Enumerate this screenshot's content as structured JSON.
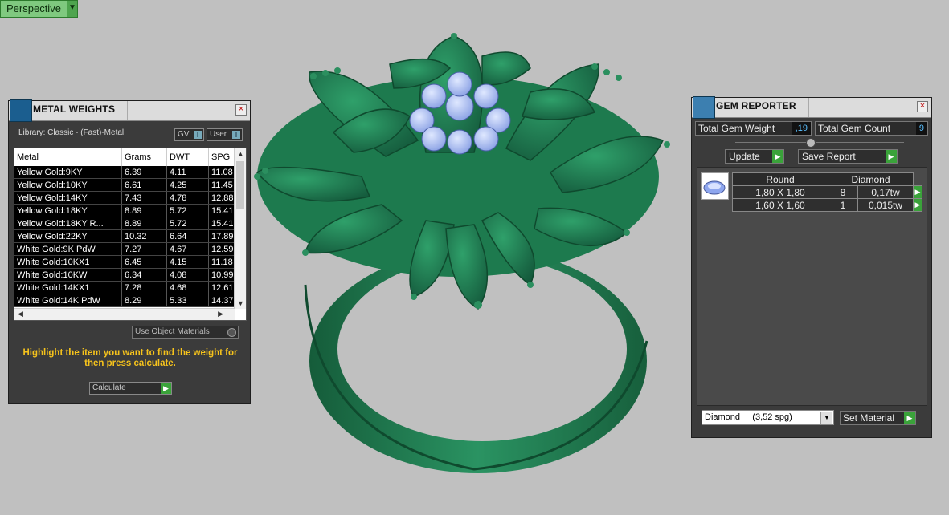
{
  "viewport": {
    "mode_label": "Perspective",
    "dropdown_icon": "chevron-down-icon",
    "colors": {
      "background": "#c0c0c0",
      "metal": "#1f7a4f",
      "gem": "#9cb4f0"
    }
  },
  "metal_weights": {
    "title": "METAL WEIGHTS",
    "library": "Library: Classic - (Fast)-Metal",
    "gv_label": "GV",
    "user_label": "User",
    "columns": [
      "Metal",
      "Grams",
      "DWT",
      "SPG"
    ],
    "rows": [
      {
        "metal": "Yellow Gold:9KY",
        "grams": "6.39",
        "dwt": "4.11",
        "spg": "11.08"
      },
      {
        "metal": "Yellow Gold:10KY",
        "grams": "6.61",
        "dwt": "4.25",
        "spg": "11.45"
      },
      {
        "metal": "Yellow Gold:14KY",
        "grams": "7.43",
        "dwt": "4.78",
        "spg": "12.88"
      },
      {
        "metal": "Yellow Gold:18KY",
        "grams": "8.89",
        "dwt": "5.72",
        "spg": "15.41"
      },
      {
        "metal": "Yellow Gold:18KY R...",
        "grams": "8.89",
        "dwt": "5.72",
        "spg": "15.41"
      },
      {
        "metal": "Yellow Gold:22KY",
        "grams": "10.32",
        "dwt": "6.64",
        "spg": "17.89"
      },
      {
        "metal": "White Gold:9K PdW",
        "grams": "7.27",
        "dwt": "4.67",
        "spg": "12.59"
      },
      {
        "metal": "White Gold:10KX1",
        "grams": "6.45",
        "dwt": "4.15",
        "spg": "11.18"
      },
      {
        "metal": "White Gold:10KW",
        "grams": "6.34",
        "dwt": "4.08",
        "spg": "10.99"
      },
      {
        "metal": "White Gold:14KX1",
        "grams": "7.28",
        "dwt": "4.68",
        "spg": "12.61"
      },
      {
        "metal": "White Gold:14K PdW",
        "grams": "8.29",
        "dwt": "5.33",
        "spg": "14.37"
      }
    ],
    "use_object_materials": "Use Object Materials",
    "hint": "Highlight the item you want to find the weight for then press calculate.",
    "calculate_label": "Calculate"
  },
  "gem_reporter": {
    "title": "GEM REPORTER",
    "total_gem_weight_label": "Total Gem Weight",
    "total_gem_weight_value": ",19",
    "total_gem_count_label": "Total Gem Count",
    "total_gem_count_value": "9",
    "update_label": "Update",
    "save_report_label": "Save Report",
    "gem": {
      "shape": "Round",
      "material": "Diamond",
      "sizes": [
        {
          "size": "1,80 X 1,80",
          "count": "8",
          "weight": "0,17tw"
        },
        {
          "size": "1,60 X 1,60",
          "count": "1",
          "weight": "0,015tw"
        }
      ]
    },
    "material_select": "Diamond     (3,52 spg)",
    "set_material_label": "Set Material"
  }
}
